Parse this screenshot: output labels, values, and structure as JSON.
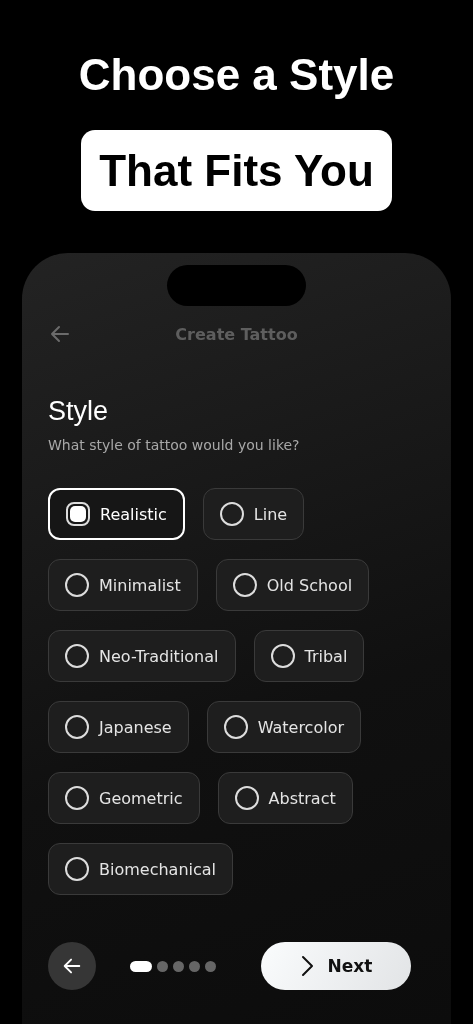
{
  "headline": {
    "line_1": "Choose a Style",
    "line_2": "That Fits You"
  },
  "app_bar": {
    "title": "Create Tattoo"
  },
  "section": {
    "title": "Style",
    "subtitle": "What style of tattoo would you like?"
  },
  "style_rows": [
    [
      {
        "label": "Realistic",
        "selected": true
      },
      {
        "label": "Line",
        "selected": false
      }
    ],
    [
      {
        "label": "Minimalist",
        "selected": false
      },
      {
        "label": "Old School",
        "selected": false
      }
    ],
    [
      {
        "label": "Neo-Traditional",
        "selected": false
      },
      {
        "label": "Tribal",
        "selected": false
      }
    ],
    [
      {
        "label": "Japanese",
        "selected": false
      },
      {
        "label": "Watercolor",
        "selected": false
      }
    ],
    [
      {
        "label": "Geometric",
        "selected": false
      },
      {
        "label": "Abstract",
        "selected": false
      }
    ],
    [
      {
        "label": "Biomechanical",
        "selected": false
      }
    ]
  ],
  "page_dots": [
    {
      "selected": true
    },
    {
      "selected": false
    },
    {
      "selected": false
    },
    {
      "selected": false
    },
    {
      "selected": false
    }
  ],
  "next_button": {
    "label": "Next"
  }
}
